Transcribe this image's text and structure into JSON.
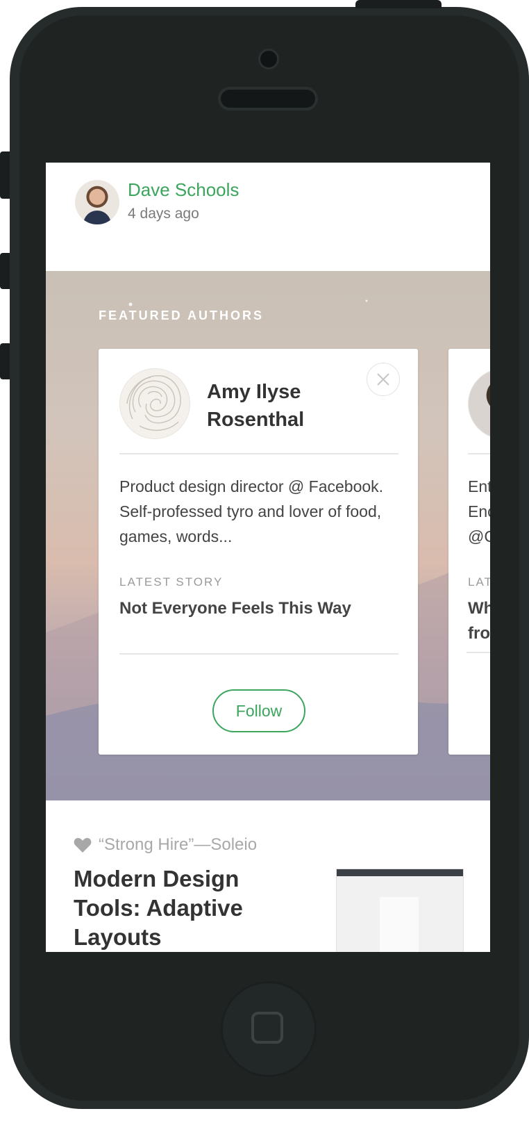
{
  "post": {
    "author": "Dave Schools",
    "time": "4 days ago"
  },
  "featured": {
    "label": "FEATURED AUTHORS",
    "cards": [
      {
        "name": "Amy Ilyse Rosenthal",
        "bio": "Product design director @ Facebook. Self-professed tyro and lover of food, games, words...",
        "latest_label": "LATEST STORY",
        "latest_title": "Not Everyone Feels This Way",
        "follow_label": "Follow",
        "dismiss_icon": "close-icon"
      },
      {
        "name": "",
        "bio": "Ent\nEnc\n@C",
        "latest_label": "LAT",
        "latest_title": "Wh\nfro"
      }
    ]
  },
  "story": {
    "recommendation": "“Strong Hire”—Soleio",
    "title": "Modern Design Tools: Adaptive Layouts"
  },
  "colors": {
    "accent": "#3ba55d",
    "phone_body": "#262b2b"
  }
}
